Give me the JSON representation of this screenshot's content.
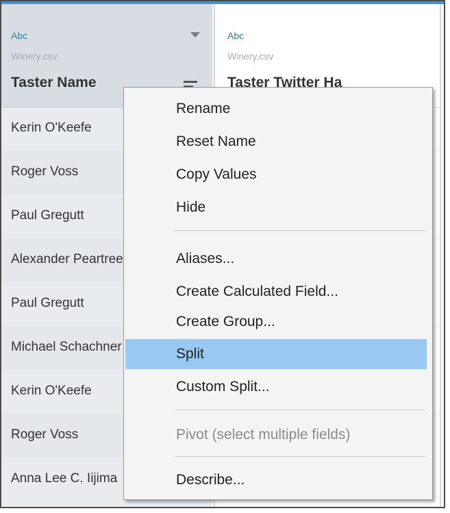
{
  "columns": [
    {
      "type_label": "Abc",
      "source": "Winery.csv",
      "name": "Taster Name",
      "rows": [
        "Kerin O'Keefe",
        "Roger Voss",
        "Paul Gregutt",
        "Alexander Peartree",
        "Paul Gregutt",
        "Michael Schachner",
        "Kerin O'Keefe",
        "Roger Voss",
        "Anna Lee C. Iijima"
      ]
    },
    {
      "type_label": "Abc",
      "source": "Winery.csv",
      "name": "Taster Twitter Ha"
    }
  ],
  "context_menu": {
    "items": [
      {
        "label": "Rename"
      },
      {
        "label": "Reset Name"
      },
      {
        "label": "Copy Values"
      },
      {
        "label": "Hide"
      },
      {
        "label": "Aliases..."
      },
      {
        "label": "Create Calculated Field..."
      },
      {
        "label": "Create Group..."
      },
      {
        "label": "Split",
        "highlighted": true
      },
      {
        "label": "Custom Split..."
      },
      {
        "label": "Pivot (select multiple fields)",
        "disabled": true
      },
      {
        "label": "Describe..."
      }
    ]
  },
  "colors": {
    "accent_bar": "#4e91c6",
    "highlight": "#99c9f3",
    "type_label": "#2f7fa7"
  }
}
